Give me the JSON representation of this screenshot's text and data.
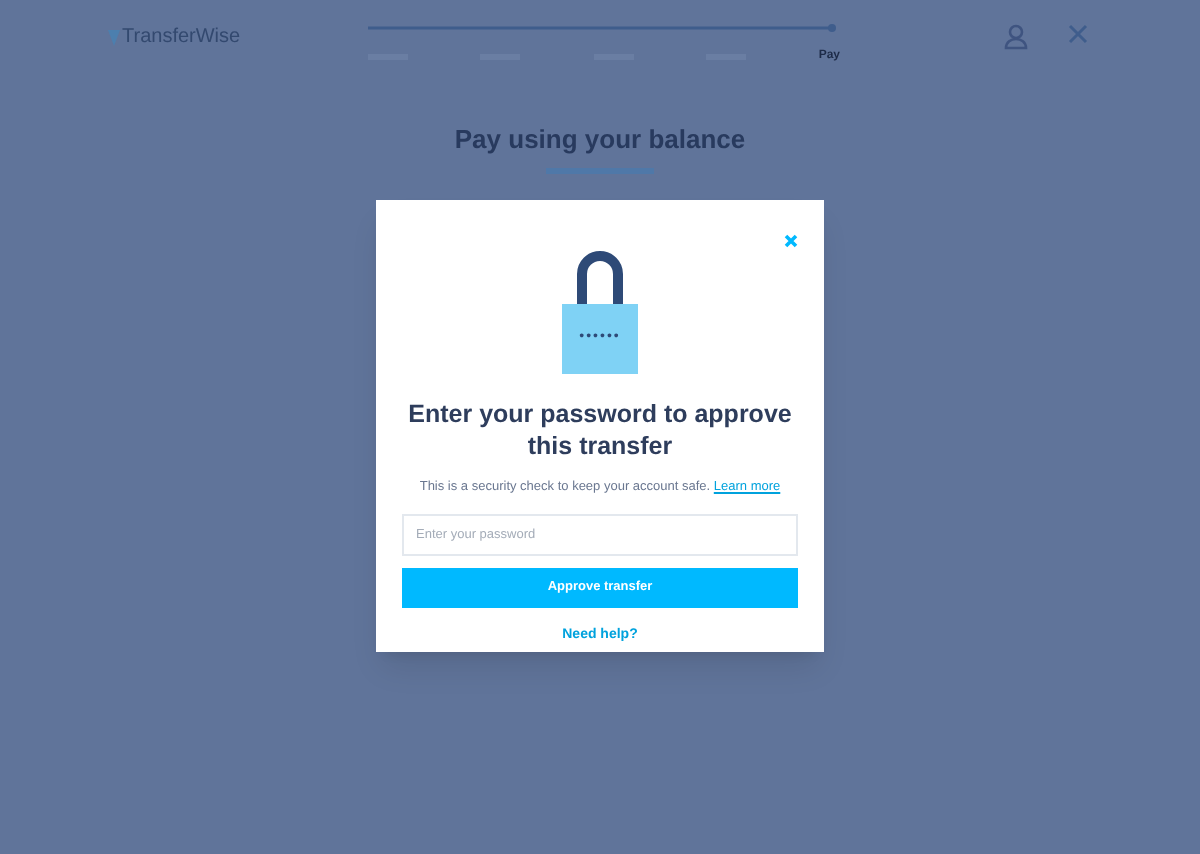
{
  "header": {
    "logo": "TransferWise",
    "steps": [
      {
        "selected": false
      },
      {
        "selected": false
      },
      {
        "selected": false
      },
      {
        "selected": false
      },
      {
        "label": "Pay",
        "selected": true
      }
    ]
  },
  "page": {
    "title": "Pay using your balance"
  },
  "modal": {
    "title": "Enter your password to approve this transfer",
    "text": "This is a security check to keep your account safe.",
    "link": "Learn more",
    "password": {
      "placeholder": "Enter your password"
    },
    "button": "Approve transfer",
    "help": "Need help?",
    "lock_dots": "••••••"
  }
}
